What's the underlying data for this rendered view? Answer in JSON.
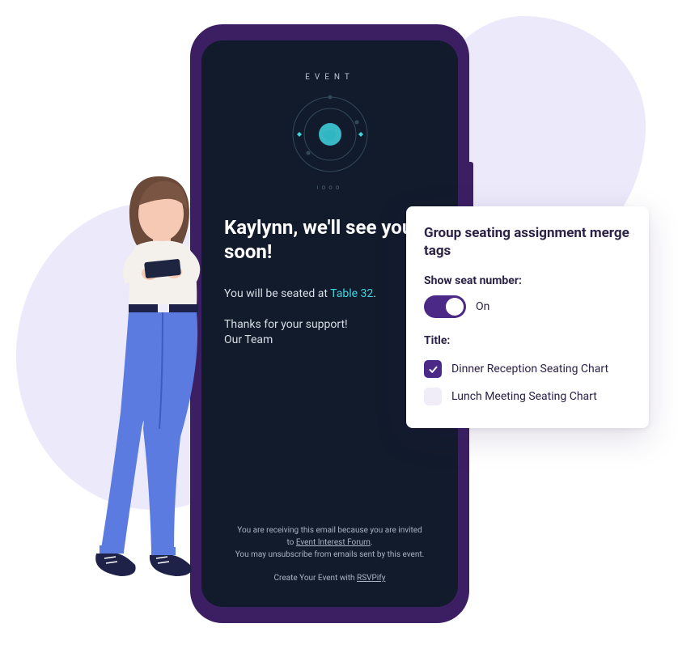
{
  "logo": {
    "word": "EVENT",
    "sub": "ıooo"
  },
  "email": {
    "headline": "Kaylynn, we'll see you soon!",
    "seated_prefix": "You will be seated at ",
    "table_label": "Table 32",
    "seated_suffix": ".",
    "thanks": "Thanks for your support!",
    "signoff": "Our Team"
  },
  "footer": {
    "line1": "You are receiving this email because you are invited",
    "line2_prefix": "to ",
    "forum": "Event Interest Forum",
    "line2_suffix": ".",
    "line3": "You may unsubscribe from emails sent by this event.",
    "create_prefix": "Create Your Event with ",
    "brand": "RSVPify"
  },
  "settings": {
    "title": "Group seating assignment merge tags",
    "show_seat_label": "Show seat number:",
    "toggle_state": "On",
    "title_label": "Title:",
    "options": [
      {
        "label": "Dinner Reception Seating Chart"
      },
      {
        "label": "Lunch Meeting Seating Chart"
      }
    ]
  }
}
